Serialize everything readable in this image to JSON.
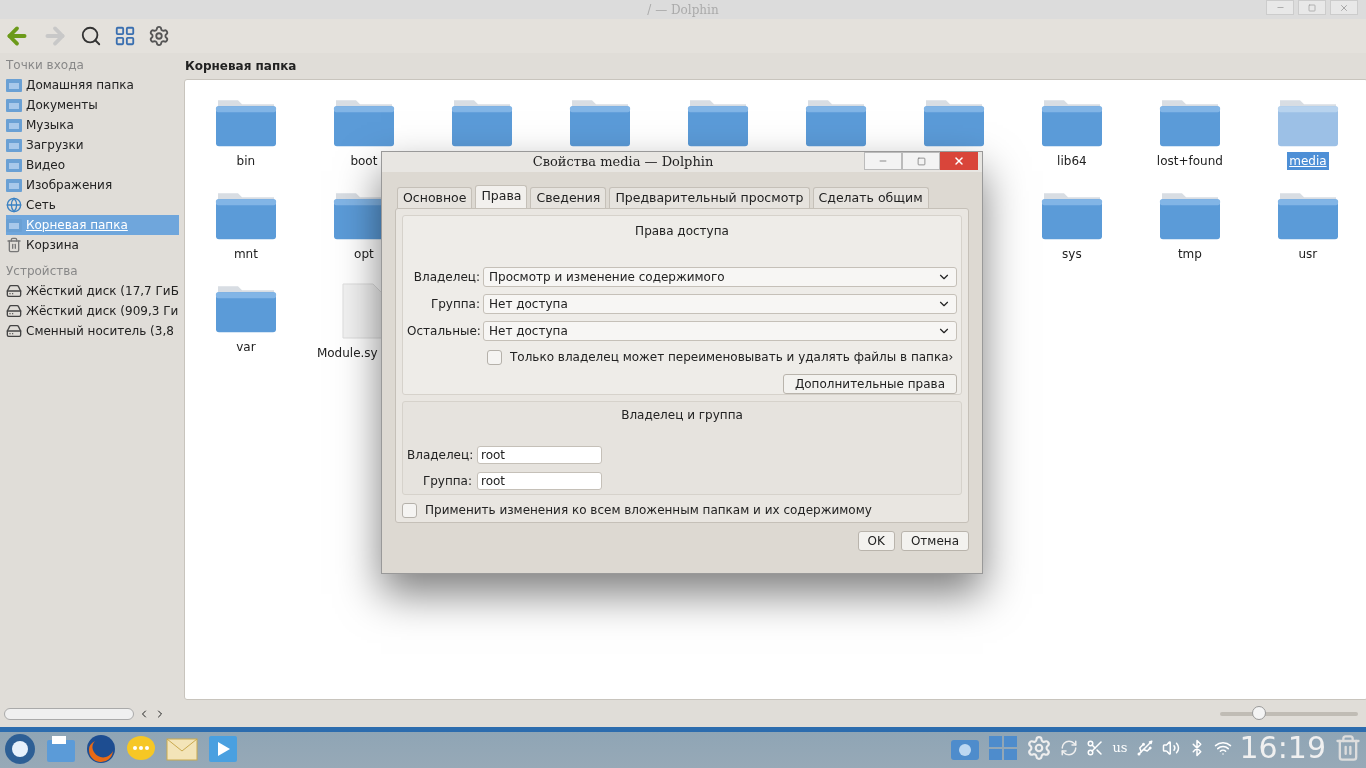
{
  "window": {
    "title": "/ — Dolphin"
  },
  "sidebar": {
    "sections": [
      {
        "title": "Точки входа",
        "items": [
          {
            "label": "Домашняя папка",
            "kind": "folder",
            "selected": false
          },
          {
            "label": "Документы",
            "kind": "folder",
            "selected": false
          },
          {
            "label": "Музыка",
            "kind": "folder",
            "selected": false
          },
          {
            "label": "Загрузки",
            "kind": "folder",
            "selected": false
          },
          {
            "label": "Видео",
            "kind": "folder",
            "selected": false
          },
          {
            "label": "Изображения",
            "kind": "folder",
            "selected": false
          },
          {
            "label": "Сеть",
            "kind": "globe",
            "selected": false
          },
          {
            "label": "Корневая папка",
            "kind": "folder",
            "selected": true
          },
          {
            "label": "Корзина",
            "kind": "trash",
            "selected": false
          }
        ]
      },
      {
        "title": "Устройства",
        "items": [
          {
            "label": "Жёсткий диск (17,7 ГиБ",
            "kind": "disk",
            "selected": false
          },
          {
            "label": "Жёсткий диск (909,3 Ги",
            "kind": "disk",
            "selected": false
          },
          {
            "label": "Сменный носитель (3,8",
            "kind": "disk",
            "selected": false
          }
        ]
      }
    ]
  },
  "location": "Корневая папка",
  "files": [
    {
      "name": "bin",
      "kind": "folder",
      "selected": false
    },
    {
      "name": "boot",
      "kind": "folder",
      "selected": false
    },
    {
      "kind": "folder",
      "selected": false
    },
    {
      "kind": "folder",
      "selected": false
    },
    {
      "kind": "folder",
      "selected": false
    },
    {
      "kind": "folder",
      "selected": false
    },
    {
      "kind": "folder",
      "selected": false
    },
    {
      "name": "lib64",
      "kind": "folder",
      "selected": false
    },
    {
      "name": "lost+found",
      "kind": "folder",
      "selected": false
    },
    {
      "name": "media",
      "kind": "folder",
      "selected": true
    },
    {
      "name": "mnt",
      "kind": "folder",
      "selected": false
    },
    {
      "name": "opt",
      "kind": "folder",
      "selected": false
    },
    {
      "kind": "covered"
    },
    {
      "kind": "covered"
    },
    {
      "kind": "covered"
    },
    {
      "kind": "covered"
    },
    {
      "kind": "covered"
    },
    {
      "name": "sys",
      "kind": "folder",
      "selected": false
    },
    {
      "name": "tmp",
      "kind": "folder",
      "selected": false
    },
    {
      "name": "usr",
      "kind": "folder",
      "selected": false
    },
    {
      "name": "var",
      "kind": "folder",
      "selected": false
    },
    {
      "name": "Module.sy",
      "kind": "file",
      "selected": false
    }
  ],
  "zoom": {
    "level": 0.28
  },
  "dialog": {
    "title": "Свойства media — Dolphin",
    "tabs": [
      {
        "label": "Основное",
        "selected": false
      },
      {
        "label": "Права",
        "selected": true
      },
      {
        "label": "Сведения",
        "selected": false
      },
      {
        "label": "Предварительный просмотр",
        "selected": false
      },
      {
        "label": "Сделать общим",
        "selected": false
      }
    ],
    "access": {
      "title": "Права доступа",
      "rows": [
        {
          "label": "Владелец:",
          "value": "Просмотр и изменение содержимого"
        },
        {
          "label": "Группа:",
          "value": "Нет доступа"
        },
        {
          "label": "Остальные:",
          "value": "Нет доступа"
        }
      ],
      "owner_only": {
        "label": "Только владелец может переименовывать и удалять файлы в папка›",
        "checked": false
      },
      "advanced_button": "Дополнительные права"
    },
    "ownership": {
      "title": "Владелец и группа",
      "fields": [
        {
          "label": "Владелец:",
          "value": "root"
        },
        {
          "label": "Группа:",
          "value": "root"
        }
      ]
    },
    "recursive": {
      "label": "Применить изменения ко всем вложенным папкам и их содержимому",
      "checked": false
    },
    "buttons": [
      "OK",
      "Отмена"
    ]
  },
  "taskbar": {
    "keyboard": "us",
    "clock": "16:19"
  }
}
